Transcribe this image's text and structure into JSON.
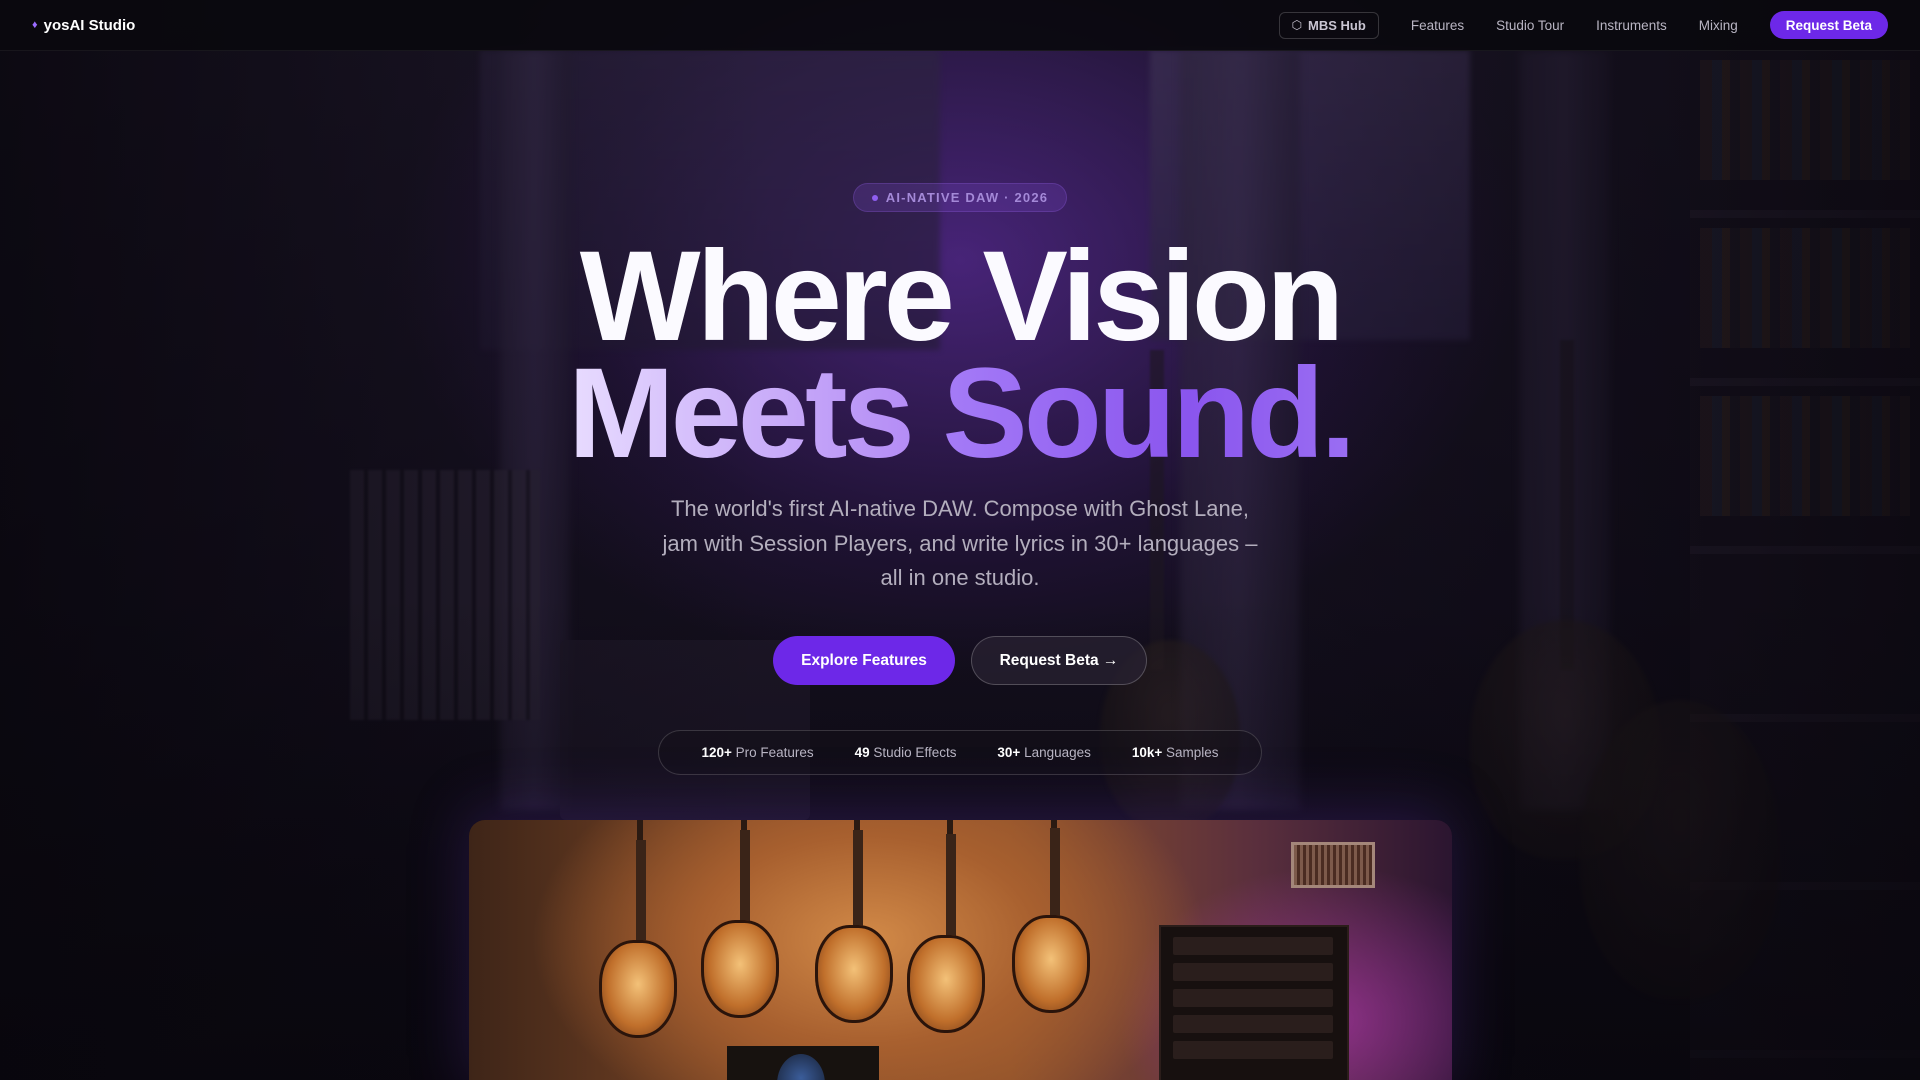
{
  "nav": {
    "brand": "yosAI Studio",
    "brand_icon": "diamond-icon",
    "hub_label": "MBS Hub",
    "hub_icon": "hexagon-icon",
    "links": [
      "Features",
      "Studio Tour",
      "Instruments",
      "Mixing"
    ],
    "cta": "Request Beta"
  },
  "hero": {
    "tag": "AI-NATIVE DAW · 2026",
    "headline_line1": "Where Vision",
    "headline_line2_a": "Meets",
    "headline_line2_b": "Sound.",
    "subtitle": "The world's first AI-native DAW. Compose with Ghost Lane, jam with Session Players, and write lyrics in 30+ languages – all in one studio.",
    "primary_button": "Explore Features",
    "secondary_button": "Request Beta →"
  },
  "stats": [
    {
      "value": "120+",
      "label": "Pro Features"
    },
    {
      "value": "49",
      "label": "Studio Effects"
    },
    {
      "value": "30+",
      "label": "Languages"
    },
    {
      "value": "10k+",
      "label": "Samples"
    }
  ],
  "colors": {
    "accent": "#6d28e8",
    "accent_light": "#9b6cff",
    "background": "#0b0912"
  }
}
